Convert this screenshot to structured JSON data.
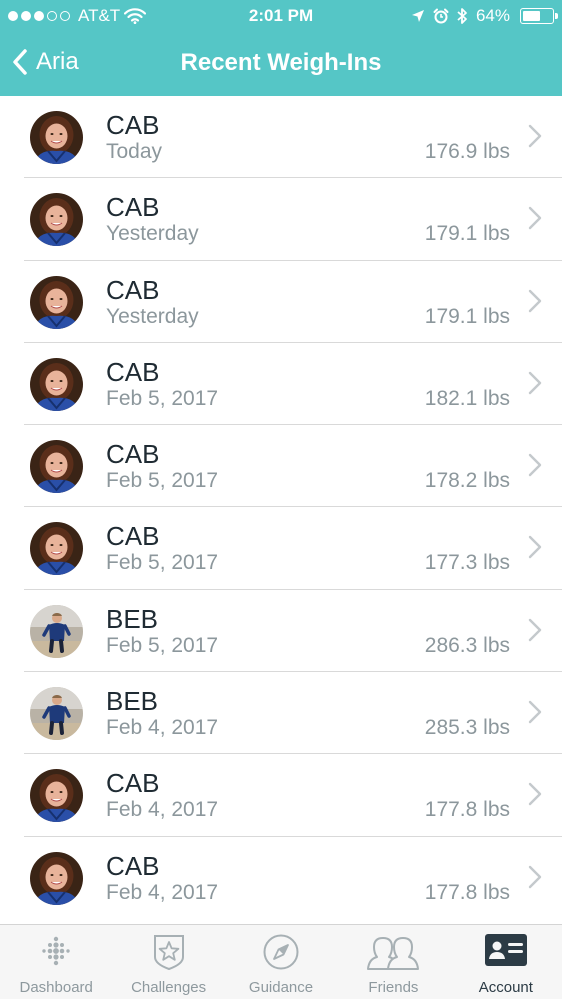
{
  "status_bar": {
    "carrier": "AT&T",
    "time": "2:01 PM",
    "battery_percent": "64%",
    "battery_level": 0.64,
    "signal_dots_filled": 3,
    "signal_dots_total": 5
  },
  "nav": {
    "back_label": "Aria",
    "title": "Recent Weigh-Ins"
  },
  "colors": {
    "header": "#55c6c6",
    "text_primary": "#1f2b33",
    "text_secondary": "#8c979c"
  },
  "weigh_ins": [
    {
      "name": "CAB",
      "date": "Today",
      "weight": "176.9 lbs",
      "avatar": "cab-avatar"
    },
    {
      "name": "CAB",
      "date": "Yesterday",
      "weight": "179.1 lbs",
      "avatar": "cab-avatar"
    },
    {
      "name": "CAB",
      "date": "Yesterday",
      "weight": "179.1 lbs",
      "avatar": "cab-avatar"
    },
    {
      "name": "CAB",
      "date": "Feb 5, 2017",
      "weight": "182.1 lbs",
      "avatar": "cab-avatar"
    },
    {
      "name": "CAB",
      "date": "Feb 5, 2017",
      "weight": "178.2 lbs",
      "avatar": "cab-avatar"
    },
    {
      "name": "CAB",
      "date": "Feb 5, 2017",
      "weight": "177.3 lbs",
      "avatar": "cab-avatar"
    },
    {
      "name": "BEB",
      "date": "Feb 5, 2017",
      "weight": "286.3 lbs",
      "avatar": "beb-avatar"
    },
    {
      "name": "BEB",
      "date": "Feb 4, 2017",
      "weight": "285.3 lbs",
      "avatar": "beb-avatar"
    },
    {
      "name": "CAB",
      "date": "Feb 4, 2017",
      "weight": "177.8 lbs",
      "avatar": "cab-avatar"
    },
    {
      "name": "CAB",
      "date": "Feb 4, 2017",
      "weight": "177.8 lbs",
      "avatar": "cab-avatar"
    }
  ],
  "tabs": [
    {
      "label": "Dashboard",
      "icon": "dashboard-icon",
      "active": false
    },
    {
      "label": "Challenges",
      "icon": "challenges-star-icon",
      "active": false
    },
    {
      "label": "Guidance",
      "icon": "compass-icon",
      "active": false
    },
    {
      "label": "Friends",
      "icon": "friends-icon",
      "active": false
    },
    {
      "label": "Account",
      "icon": "account-card-icon",
      "active": true
    }
  ]
}
